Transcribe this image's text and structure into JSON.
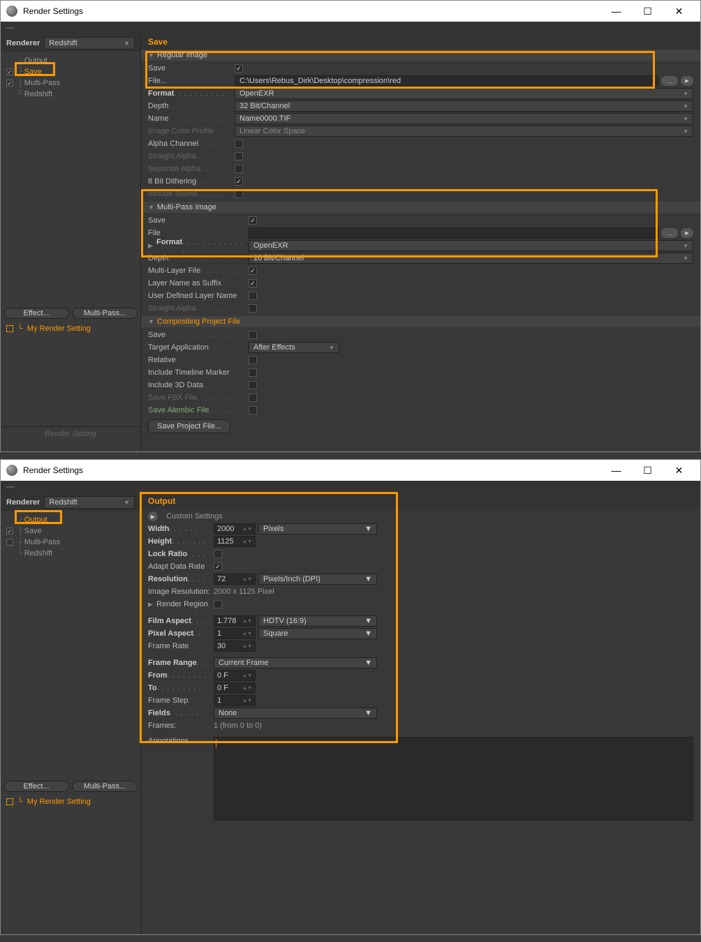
{
  "window1": {
    "title": "Render Settings",
    "renderer_label": "Renderer",
    "renderer_value": "Redshift",
    "tree": {
      "output": "Output",
      "save": "Save",
      "multipass": "Multi-Pass",
      "redshift": "Redshift"
    },
    "effect_btn": "Effect...",
    "multipass_btn": "Multi-Pass...",
    "my_render": "My Render Setting",
    "render_setting_label": "Render Setting",
    "main": {
      "header": "Save",
      "regular": {
        "section": "Regular Image",
        "save_label": "Save",
        "file_label": "File...",
        "file_value": "C:\\Users\\Rebus_Dirk\\Desktop\\compression\\red",
        "format_label": "Format",
        "format_value": "OpenEXR",
        "depth_label": "Depth",
        "depth_value": "32 Bit/Channel",
        "name_label": "Name",
        "name_value": "Name0000.TIF",
        "icp_label": "Image Color Profile",
        "icp_value": "Linear Color Space",
        "alpha_label": "Alpha Channel",
        "straight_label": "Straight Alpha",
        "separate_label": "Separate Alpha",
        "dither_label": "8 Bit Dithering",
        "sound_label": "Include Sound"
      },
      "multipass": {
        "section": "Multi-Pass Image",
        "save_label": "Save",
        "file_label": "File",
        "file_value": "",
        "format_label": "Format",
        "format_value": "OpenEXR",
        "depth_label": "Depth",
        "depth_value": "16 Bit/Channel",
        "mlf_label": "Multi-Layer File",
        "lns_label": "Layer Name as Suffix",
        "udln_label": "User Defined Layer Name",
        "straight_label": "Straight Alpha"
      },
      "cpf": {
        "section": "Compositing Project File",
        "save_label": "Save",
        "target_label": "Target Application",
        "target_value": "After Effects",
        "relative_label": "Relative",
        "itm_label": "Include Timeline Marker",
        "i3d_label": "Include 3D Data",
        "fbx_label": "Save FBX File",
        "alembic_label": "Save Alembic File",
        "save_project_btn": "Save Project File..."
      }
    }
  },
  "window2": {
    "title": "Render Settings",
    "renderer_label": "Renderer",
    "renderer_value": "Redshift",
    "tree": {
      "output": "Output",
      "save": "Save",
      "multipass": "Multi-Pass",
      "redshift": "Redshift"
    },
    "effect_btn": "Effect...",
    "multipass_btn": "Multi-Pass...",
    "my_render": "My Render Setting",
    "main": {
      "header": "Output",
      "custom": "Custom Settings",
      "width_label": "Width",
      "width_value": "2000",
      "width_unit": "Pixels",
      "height_label": "Height",
      "height_value": "1125",
      "lock_label": "Lock Ratio",
      "adapt_label": "Adapt Data Rate",
      "res_label": "Resolution",
      "res_value": "72",
      "res_unit": "Pixels/Inch (DPI)",
      "img_res_label": "Image Resolution:",
      "img_res_value": "2000 x 1125 Pixel",
      "render_region_label": "Render Region",
      "film_label": "Film Aspect",
      "film_value": "1.778",
      "film_preset": "HDTV (16:9)",
      "pixel_label": "Pixel Aspect",
      "pixel_value": "1",
      "pixel_preset": "Square",
      "fps_label": "Frame Rate",
      "fps_value": "30",
      "range_label": "Frame Range",
      "range_value": "Current Frame",
      "from_label": "From",
      "from_value": "0 F",
      "to_label": "To",
      "to_value": "0 F",
      "step_label": "Frame Step",
      "step_value": "1",
      "fields_label": "Fields",
      "fields_value": "None",
      "frames_label": "Frames:",
      "frames_value": "1 (from 0 to 0)",
      "annotations_label": "Annotations"
    }
  }
}
